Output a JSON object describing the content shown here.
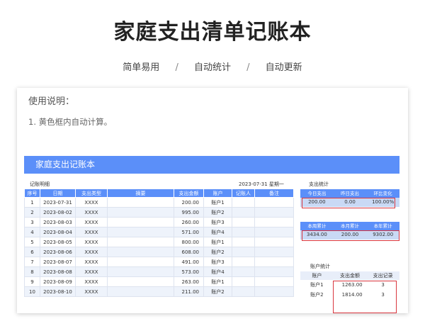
{
  "page": {
    "title": "家庭支出清单记账本",
    "features": [
      "简单易用",
      "自动统计",
      "自动更新"
    ],
    "separator": "/"
  },
  "instructions": {
    "title": "使用说明：",
    "lines": [
      "1. 黄色框内自动计算。"
    ]
  },
  "sheet": {
    "header_title": "家庭支出记账本",
    "ledger_label": "记账明细",
    "date_label": "2023-07-31  星期一",
    "columns": [
      "序号",
      "日期",
      "支出类型",
      "摘要",
      "支出金额",
      "账户",
      "记账人",
      "备注"
    ],
    "rows": [
      {
        "no": "1",
        "date": "2023-07-31",
        "type": "XXXX",
        "summary": "",
        "amount": "200.00",
        "account": "账户1",
        "recorder": "",
        "note": ""
      },
      {
        "no": "2",
        "date": "2023-08-02",
        "type": "XXXX",
        "summary": "",
        "amount": "995.00",
        "account": "账户2",
        "recorder": "",
        "note": ""
      },
      {
        "no": "3",
        "date": "2023-08-03",
        "type": "XXXX",
        "summary": "",
        "amount": "260.00",
        "account": "账户3",
        "recorder": "",
        "note": ""
      },
      {
        "no": "4",
        "date": "2023-08-04",
        "type": "XXXX",
        "summary": "",
        "amount": "571.00",
        "account": "账户4",
        "recorder": "",
        "note": ""
      },
      {
        "no": "5",
        "date": "2023-08-05",
        "type": "XXXX",
        "summary": "",
        "amount": "800.00",
        "account": "账户1",
        "recorder": "",
        "note": ""
      },
      {
        "no": "6",
        "date": "2023-08-06",
        "type": "XXXX",
        "summary": "",
        "amount": "608.00",
        "account": "账户2",
        "recorder": "",
        "note": ""
      },
      {
        "no": "7",
        "date": "2023-08-07",
        "type": "XXXX",
        "summary": "",
        "amount": "491.00",
        "account": "账户3",
        "recorder": "",
        "note": ""
      },
      {
        "no": "8",
        "date": "2023-08-08",
        "type": "XXXX",
        "summary": "",
        "amount": "573.00",
        "account": "账户4",
        "recorder": "",
        "note": ""
      },
      {
        "no": "9",
        "date": "2023-08-09",
        "type": "XXXX",
        "summary": "",
        "amount": "263.00",
        "account": "账户1",
        "recorder": "",
        "note": ""
      },
      {
        "no": "10",
        "date": "2023-08-10",
        "type": "XXXX",
        "summary": "",
        "amount": "211.00",
        "account": "账户2",
        "recorder": "",
        "note": ""
      }
    ]
  },
  "stats": {
    "title": "支出统计",
    "daily": {
      "headers": [
        "今日支出",
        "昨日支出",
        "环比变化"
      ],
      "values": [
        "200.00",
        "0.00",
        "100.00%"
      ]
    },
    "period": {
      "headers": [
        "本周累计",
        "本月累计",
        "本年累计"
      ],
      "values": [
        "3434.00",
        "200.00",
        "9302.00"
      ]
    }
  },
  "accounts": {
    "title": "账户统计",
    "headers": [
      "账户",
      "支出金额",
      "支出记录"
    ],
    "rows": [
      {
        "name": "账户1",
        "amount": "1263.00",
        "count": "3"
      },
      {
        "name": "账户2",
        "amount": "1814.00",
        "count": "3"
      }
    ]
  },
  "colors": {
    "accent": "#5b8ff9",
    "highlight_box": "#d9363e",
    "value_cell": "#c9d9f5"
  }
}
